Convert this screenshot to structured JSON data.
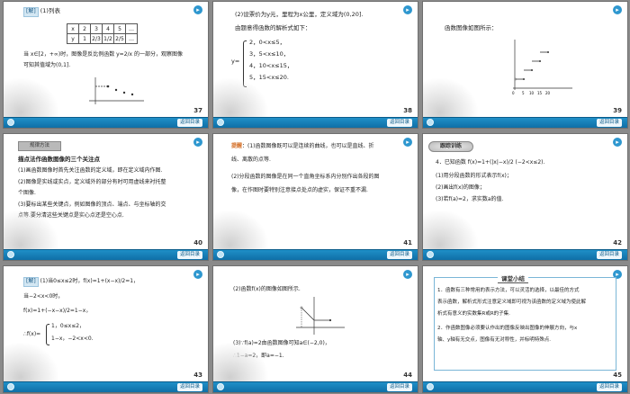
{
  "common": {
    "back_label": "返回目录"
  },
  "slides": [
    {
      "page": "37",
      "tag": "[解]",
      "l1": "(1)列表",
      "table_x": [
        "x",
        "2",
        "3",
        "4",
        "5",
        "…"
      ],
      "table_y": [
        "y",
        "1",
        "2/3",
        "1/2",
        "2/5",
        "…"
      ],
      "l2": "当 x∈[2，+∞)时，图像是反比例函数 y=2/x 的一部分，观察图像",
      "l3": "可知其值域为(0,1]."
    },
    {
      "page": "38",
      "l1": "(2)设票价为y元，里程为x公里，定义域为(0,20].",
      "l2": "由题意得函数的解析式如下：",
      "y_label": "y=",
      "cases": [
        "2，0<x≤5，",
        "3，5<x≤10，",
        "4，10<x≤15，",
        "5，15<x≤20."
      ]
    },
    {
      "page": "39",
      "l1": "函数图像如图所示：",
      "axis_ticks": [
        "0",
        "5",
        "10",
        "15",
        "20"
      ]
    },
    {
      "page": "40",
      "header": "规律方法",
      "l1": "描点法作函数图像的三个关注点",
      "l2": "(1)画函数图像时首先关注函数的定义域，即在定义域内作图.",
      "l3": "(2)图像是实线或实点，定义域外的部分有时可用虚线来衬托整",
      "l4": "个图像.",
      "l5": "(3)要标出某些关键点，例如图像的顶点、端点、与坐标轴的交",
      "l6": "点等.要分清这些关键点是实心点还是空心点."
    },
    {
      "page": "41",
      "tag": "提醒",
      "l1": "：(1)函数图像既可以是连续的曲线，也可以是直线、折",
      "l2": "线、离散的点等.",
      "l3": "(2)分段函数的图像是在同一个直角坐标系内分别作出各段的图",
      "l4": "像，在作图时要特别注意接点处点的虚实，保证不重不漏."
    },
    {
      "page": "42",
      "banner": "跟踪训练",
      "l1": "4．已知函数 f(x)=1+(|x|−x)/2 (−2<x≤2).",
      "l2": "(1)用分段函数的形式表示f(x)；",
      "l3": "(2)画出f(x)的图像；",
      "l4": "(3)若f(a)=2，求实数a的值."
    },
    {
      "page": "43",
      "tag": "[解]",
      "l1": "(1)当0≤x≤2时，f(x)=1+(x−x)/2=1，",
      "l2": "当−2<x<0时，",
      "l3": "f(x)=1+(−x−x)/2=1−x，",
      "l4a": "∴f(x)=",
      "c1": "1，0≤x≤2，",
      "c2": "1−x，−2<x<0."
    },
    {
      "page": "44",
      "l1": "(2)函数f(x)的图像如图所示.",
      "l2": "(3)∵f(a)=2由函数图像可知a∈(−2,0)，",
      "l3": "∴1−a=2，即a=−1."
    },
    {
      "page": "45",
      "title": "课堂小结",
      "l1": "1．函数有三种常用的表示方法，可以灵活的选择，以最佳的方式",
      "l2": "表示函数，解析式形式注意定义域即可视为该函数的定义域为使此解",
      "l3": "析式有意义的实数集R或R的子集.",
      "l4": "2．作函数图像必须要认作出的图像反映出图像的伸展方向，与x",
      "l5": "轴、y轴有无交点，图像有无对称性，并标明特殊点."
    }
  ]
}
